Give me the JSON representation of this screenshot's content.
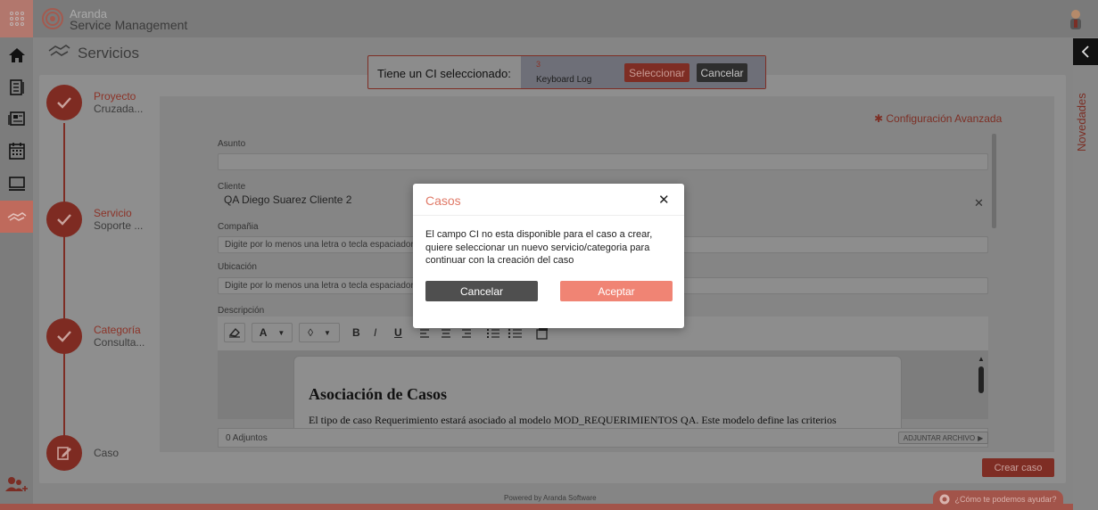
{
  "header": {
    "brand_line1": "Aranda",
    "brand_line2": "Service Management"
  },
  "page": {
    "title": "Servicios"
  },
  "nav": {
    "items": [
      {
        "icon": "home-icon"
      },
      {
        "icon": "document-list-icon"
      },
      {
        "icon": "news-icon"
      },
      {
        "icon": "calendar-icon"
      },
      {
        "icon": "monitor-icon"
      },
      {
        "icon": "services-icon",
        "active": true
      }
    ],
    "bottom_icon": "add-users-icon"
  },
  "stepper": {
    "steps": [
      {
        "title": "Proyecto",
        "subtitle": "Cruzada..."
      },
      {
        "title": "Servicio",
        "subtitle": "Soporte ..."
      },
      {
        "title": "Categoría",
        "subtitle": "Consulta..."
      },
      {
        "title": "",
        "subtitle": "Caso"
      }
    ]
  },
  "form": {
    "config_advanced": "Configuración Avanzada",
    "asunto_label": "Asunto",
    "cliente_label": "Cliente",
    "cliente_value": "QA Diego  Suarez Cliente 2",
    "compania_label": "Compañia",
    "compania_placeholder": "Digite por lo menos una letra o tecla espaciadora",
    "ubicacion_label": "Ubicación",
    "ubicacion_placeholder": "Digite por lo menos una letra o tecla espaciadora",
    "descripcion_label": "Descripción",
    "editor": {
      "font_label": "A",
      "bold": "B",
      "italic": "I",
      "underline": "U",
      "heading": "Asociación de Casos",
      "first_line": "El tipo de caso Requerimiento estará asociado al modelo MOD_REQUERIMIENTOS QA. Este modelo define las criterios"
    },
    "attachments_count": "0 Adjuntos",
    "attach_button": "ADJUNTAR ARCHIVO",
    "create_button": "Crear caso"
  },
  "ci_bar": {
    "label": "Tiene un CI seleccionado:",
    "ci_number": "3",
    "ci_name": "Keyboard Log",
    "select_button": "Seleccionar",
    "cancel_button": "Cancelar"
  },
  "right_panel": {
    "label": "Novedades"
  },
  "footer": {
    "powered": "Powered by Aranda Software",
    "help": "¿Cómo te podemos ayudar?"
  },
  "modal": {
    "title": "Casos",
    "message": "El campo CI no esta disponible para el caso a crear, quiere seleccionar un nuevo servicio/categoria para continuar con la creación del caso",
    "cancel": "Cancelar",
    "accept": "Aceptar"
  },
  "colors": {
    "accent": "#e07564",
    "accent_dark_overlay": "#7e2d24",
    "modal_title": "#e07a68",
    "accept_button": "#f08474",
    "cancel_button": "#4f4f4f"
  }
}
